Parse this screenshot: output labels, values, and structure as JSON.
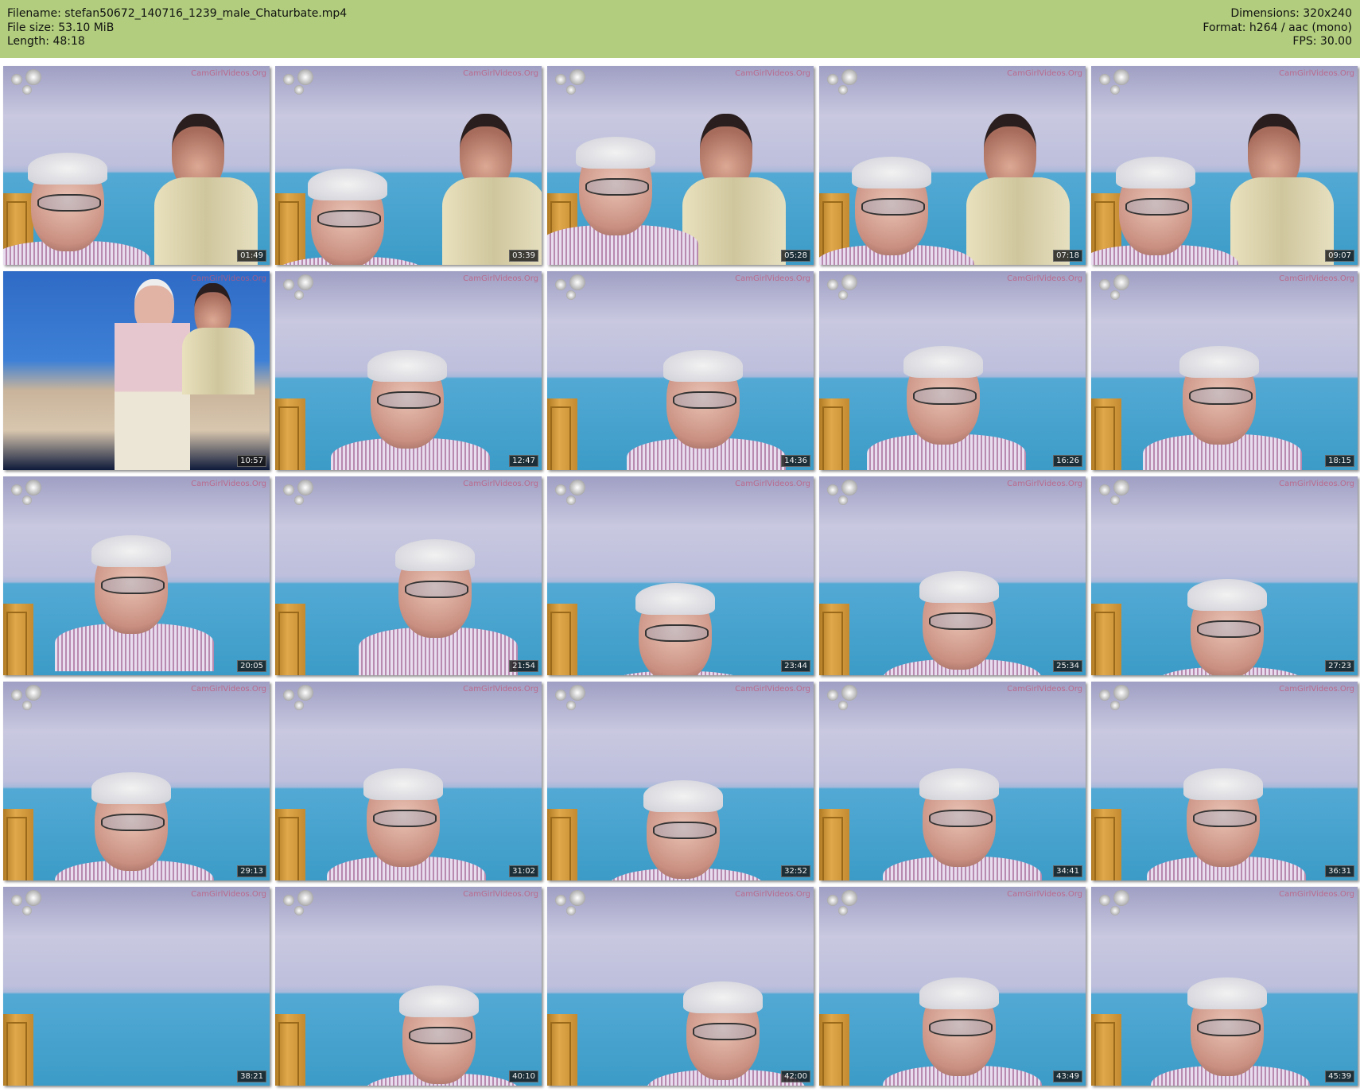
{
  "header": {
    "filename": "Filename: stefan50672_140716_1239_male_Chaturbate.mp4",
    "filesize": "File size: 53.10 MiB",
    "length": "Length: 48:18",
    "dimensions": "Dimensions: 320x240",
    "format": "Format: h264 / aac (mono)",
    "fps": "FPS: 30.00"
  },
  "watermark": "CamGirlVideos.Org",
  "colors": {
    "header_bg": "#b1cd7d"
  },
  "thumbnails": [
    {
      "time": "01:49"
    },
    {
      "time": "03:39"
    },
    {
      "time": "05:28"
    },
    {
      "time": "07:18"
    },
    {
      "time": "09:07"
    },
    {
      "time": "10:57"
    },
    {
      "time": "12:47"
    },
    {
      "time": "14:36"
    },
    {
      "time": "16:26"
    },
    {
      "time": "18:15"
    },
    {
      "time": "20:05"
    },
    {
      "time": "21:54"
    },
    {
      "time": "23:44"
    },
    {
      "time": "25:34"
    },
    {
      "time": "27:23"
    },
    {
      "time": "29:13"
    },
    {
      "time": "31:02"
    },
    {
      "time": "32:52"
    },
    {
      "time": "34:41"
    },
    {
      "time": "36:31"
    },
    {
      "time": "38:21"
    },
    {
      "time": "40:10"
    },
    {
      "time": "42:00"
    },
    {
      "time": "43:49"
    },
    {
      "time": "45:39"
    }
  ]
}
